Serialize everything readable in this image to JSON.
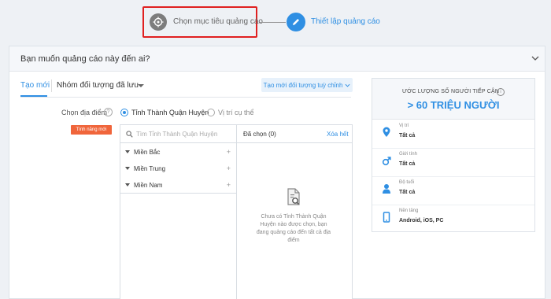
{
  "stepper": {
    "step1_label": "Chọn mục tiêu quảng cáo",
    "step2_label": "Thiết lập quảng cáo"
  },
  "card": {
    "title": "Bạn muốn quảng cáo này đến ai?"
  },
  "tabs": {
    "new_label": "Tạo mới",
    "saved_label": "Nhóm đối tượng đã lưu",
    "create_custom_label": "Tạo mới đối tượng tuỳ chỉnh"
  },
  "location": {
    "label": "Chọn địa điểm",
    "help": "?",
    "option_province": "Tỉnh Thành Quận Huyện",
    "option_specific": "Vị trí cụ thể",
    "new_feature_badge": "Tính năng mới"
  },
  "picker": {
    "search_placeholder": "Tìm Tỉnh Thành Quận Huyện",
    "regions": [
      "Miền Bắc",
      "Miền Trung",
      "Miền Nam"
    ],
    "plus": "+",
    "chosen_label": "Đã chọn (0)",
    "clear_all": "Xóa hết",
    "empty_message": "Chưa có Tỉnh Thành Quận Huyện nào được chọn, bạn đang quảng cáo đến tất cả địa điểm"
  },
  "estimate": {
    "title": "ƯỚC LƯỢNG SỐ NGƯỜI TIẾP CẬN",
    "info": "i",
    "value": "> 60 TRIỆU NGƯỜI",
    "rows": [
      {
        "label": "Vị trí",
        "value": "Tất cả",
        "icon": "location-pin-icon"
      },
      {
        "label": "Giới tính",
        "value": "Tất cả",
        "icon": "gender-icon"
      },
      {
        "label": "Độ tuổi",
        "value": "Tất cả",
        "icon": "person-icon"
      },
      {
        "label": "Nền tảng",
        "value": "Android, iOS, PC",
        "icon": "mobile-icon"
      }
    ]
  },
  "colors": {
    "accent": "#2f8fe3",
    "highlight_border": "#e02020",
    "badge": "#f0653b"
  }
}
